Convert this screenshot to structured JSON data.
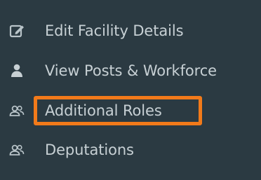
{
  "sidebar": {
    "items": [
      {
        "label": "Edit Facility Details",
        "icon": "edit-icon"
      },
      {
        "label": "View Posts & Workforce",
        "icon": "user-icon"
      },
      {
        "label": "Additional Roles",
        "icon": "users-icon",
        "highlighted": true
      },
      {
        "label": "Deputations",
        "icon": "users-icon"
      }
    ]
  },
  "colors": {
    "background": "#2b3a42",
    "text": "#c7d0d4",
    "highlight": "#f27a1a"
  }
}
